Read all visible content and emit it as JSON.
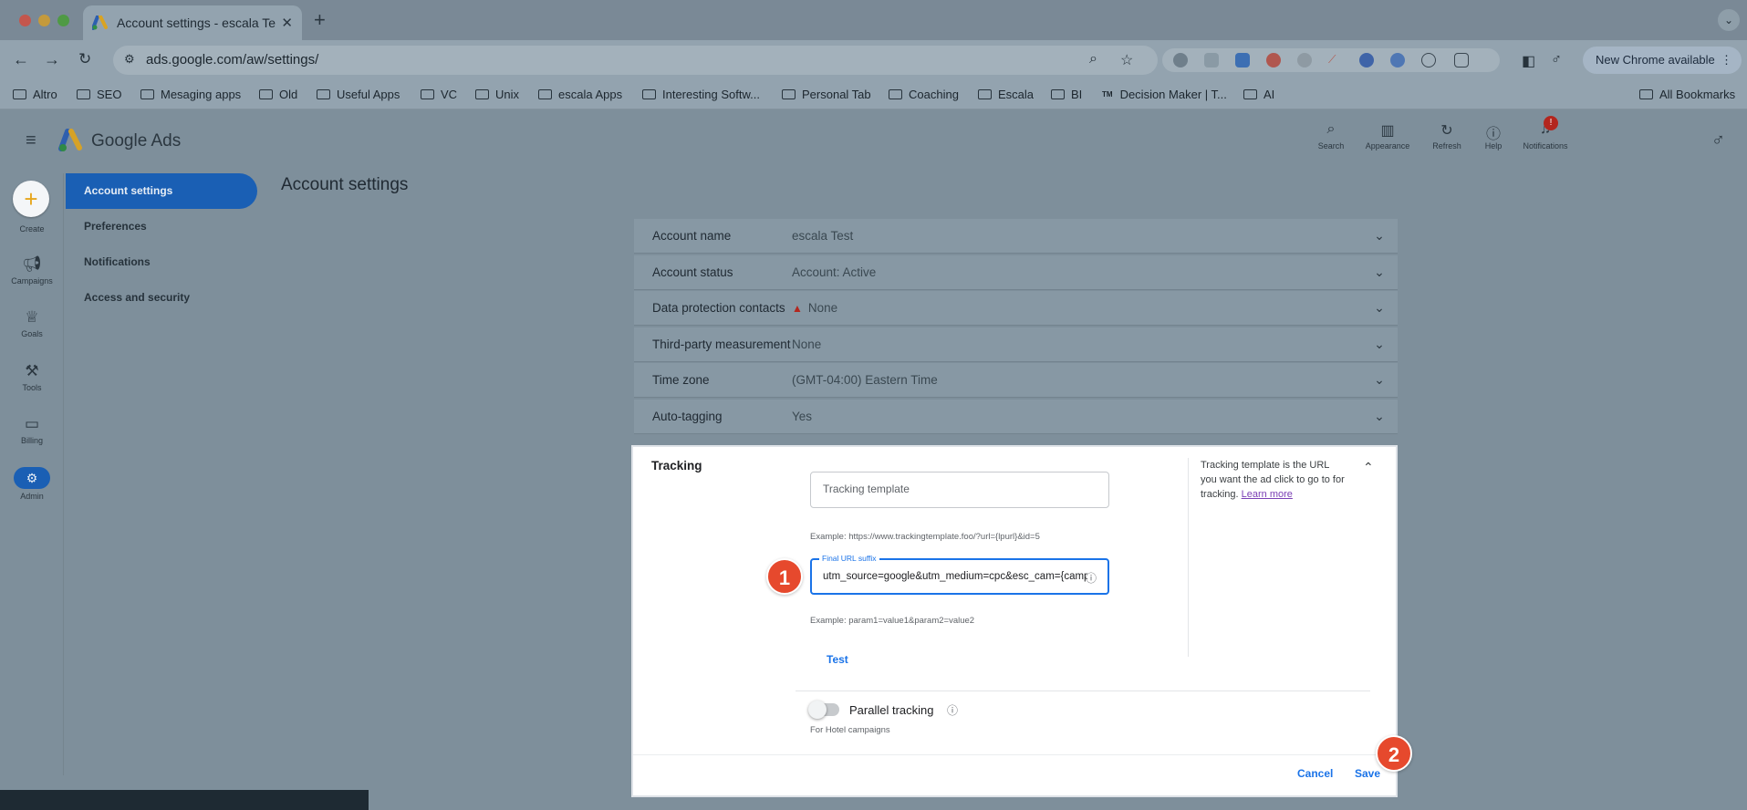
{
  "browser": {
    "tab_title": "Account settings - escala Te",
    "tab_close": "✕",
    "new_tab": "+",
    "url": "ads.google.com/aw/settings/",
    "update_label": "New Chrome available",
    "update_menu": "⋮"
  },
  "bookmarks": [
    {
      "label": "Altro"
    },
    {
      "label": "SEO"
    },
    {
      "label": "Mesaging apps"
    },
    {
      "label": "Old"
    },
    {
      "label": "Useful Apps"
    },
    {
      "label": "VC"
    },
    {
      "label": "Unix"
    },
    {
      "label": "escala Apps"
    },
    {
      "label": "Interesting Softw..."
    },
    {
      "label": "Personal Tab"
    },
    {
      "label": "Coaching"
    },
    {
      "label": "Escala"
    },
    {
      "label": "BI"
    },
    {
      "label": "Decision Maker | T..."
    },
    {
      "label": "AI"
    }
  ],
  "bookmarks_right": "All Bookmarks",
  "app": {
    "product_name": "Google Ads",
    "header_actions": [
      {
        "label": "Search",
        "icon": "search-icon"
      },
      {
        "label": "Appearance",
        "icon": "appearance-icon"
      },
      {
        "label": "Refresh",
        "icon": "refresh-icon"
      },
      {
        "label": "Help",
        "icon": "help-icon"
      },
      {
        "label": "Notifications",
        "icon": "bell-icon",
        "badge": "!"
      }
    ]
  },
  "rail": {
    "create_label": "Create",
    "items": [
      {
        "label": "Campaigns",
        "icon": "megaphone-icon"
      },
      {
        "label": "Goals",
        "icon": "trophy-icon"
      },
      {
        "label": "Tools",
        "icon": "tools-icon"
      },
      {
        "label": "Billing",
        "icon": "billing-icon"
      },
      {
        "label": "Admin",
        "icon": "gear-icon"
      }
    ]
  },
  "subnav": {
    "items": [
      {
        "label": "Account settings",
        "active": true
      },
      {
        "label": "Preferences"
      },
      {
        "label": "Notifications"
      },
      {
        "label": "Access and security"
      }
    ]
  },
  "page_title": "Account settings",
  "settings_rows": [
    {
      "label": "Account name",
      "value": "escala Test"
    },
    {
      "label": "Account status",
      "value": "Account: Active"
    },
    {
      "label": "Data protection contacts",
      "value": "None",
      "warning": true
    },
    {
      "label": "Third-party measurement",
      "value": "None"
    },
    {
      "label": "Time zone",
      "value": "(GMT-04:00) Eastern Time"
    },
    {
      "label": "Auto-tagging",
      "value": "Yes"
    }
  ],
  "tracking": {
    "label": "Tracking",
    "template_placeholder": "Tracking template",
    "template_example": "Example: https://www.trackingtemplate.foo/?url={lpurl}&id=5",
    "suffix_label": "Final URL suffix",
    "suffix_value": "utm_source=google&utm_medium=cpc&esc_cam={campaignid}",
    "suffix_example": "Example: param1=value1&param2=value2",
    "test_label": "Test",
    "help_text": "Tracking template is the URL you want the ad click to go to for tracking.",
    "learn_more": "Learn more",
    "parallel_label": "Parallel tracking",
    "parallel_sub": "For Hotel campaigns",
    "parallel_on": false,
    "cancel_label": "Cancel",
    "save_label": "Save"
  },
  "steps": [
    "1",
    "2"
  ],
  "colors": {
    "accent": "#1a73e8",
    "active_nav": "#1a5fb4",
    "step_marker": "#e6492d",
    "overlay": "#7e8f9b"
  }
}
